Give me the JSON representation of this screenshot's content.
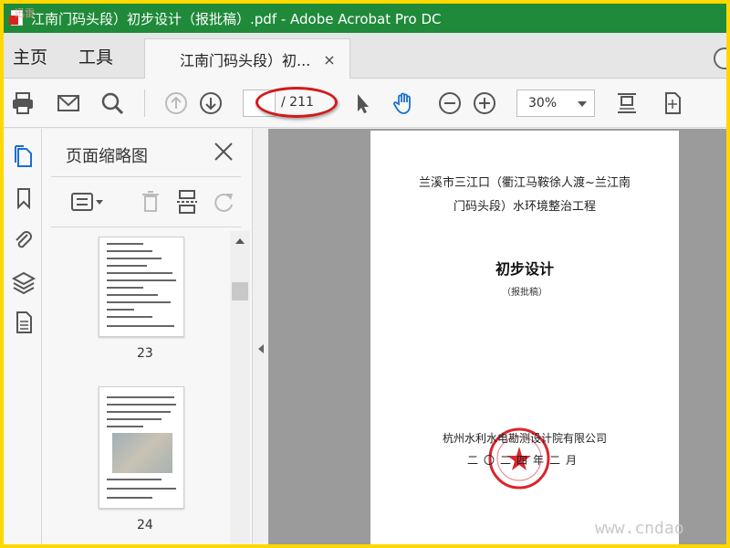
{
  "window": {
    "title": "江南门码头段）初步设计（报批稿）.pdf - Adobe Acrobat Pro DC",
    "logo_text": "迅雷"
  },
  "menu": {
    "home": "主页",
    "tools": "工具"
  },
  "tab": {
    "label": "江南门码头段）初...",
    "close": "×"
  },
  "toolbar": {
    "page_current": "",
    "page_total": "/ 211",
    "zoom": "30%"
  },
  "panel": {
    "title": "页面缩略图",
    "thumbnails": [
      {
        "page": "23"
      },
      {
        "page": "24"
      }
    ]
  },
  "document": {
    "title_line1": "兰溪市三江口（衢江马鞍徐人渡~兰江南",
    "title_line2": "门码头段）水环境整治工程",
    "heading": "初步设计",
    "subheading": "（报批稿）",
    "organization": "杭州水利水电勘测设计院有限公司",
    "date": "二〇二四年二月",
    "seal_color": "#d9262c"
  },
  "watermark": "www.cndao",
  "colors": {
    "titlebar": "#1f8a3a",
    "annotation": "#d11b1b",
    "hand_tool": "#1a6fd1",
    "outer_border": "#ffd800"
  }
}
